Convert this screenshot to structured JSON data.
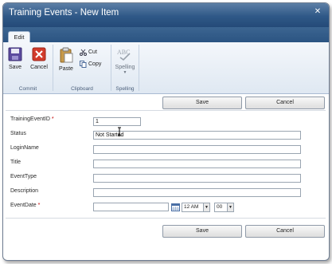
{
  "window": {
    "title": "Training Events - New Item"
  },
  "tabs": [
    {
      "label": "Edit"
    }
  ],
  "ribbon": {
    "commit": {
      "label": "Commit",
      "save": "Save",
      "cancel": "Cancel"
    },
    "clipboard": {
      "label": "Clipboard",
      "paste": "Paste",
      "cut": "Cut",
      "copy": "Copy"
    },
    "spelling": {
      "label": "Spelling",
      "button": "Spelling"
    }
  },
  "top_actions": {
    "save": "Save",
    "cancel": "Cancel"
  },
  "fields": [
    {
      "label": "TrainingEventID",
      "required": true,
      "value": "1"
    },
    {
      "label": "Status",
      "required": false,
      "value": "Not Started"
    },
    {
      "label": "LoginName",
      "required": false,
      "value": ""
    },
    {
      "label": "Title",
      "required": false,
      "value": ""
    },
    {
      "label": "EventType",
      "required": false,
      "value": ""
    },
    {
      "label": "Description",
      "required": false,
      "value": ""
    },
    {
      "label": "EventDate",
      "required": true,
      "value": ""
    }
  ],
  "event_date": {
    "hour": "12 AM",
    "minute": "00"
  },
  "bottom_actions": {
    "save": "Save",
    "cancel": "Cancel"
  },
  "required_marker": "*",
  "colors": {
    "titlebar": "#2f5887",
    "required": "#c00000"
  }
}
